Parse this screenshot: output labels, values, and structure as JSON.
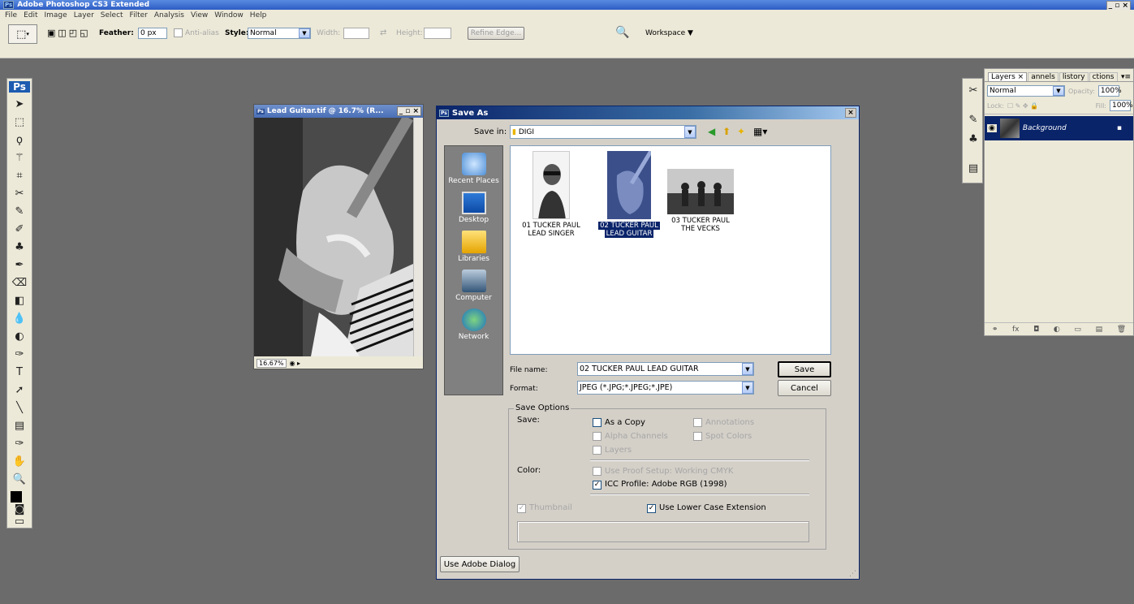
{
  "app": {
    "title": "Adobe Photoshop CS3 Extended",
    "menu": [
      "File",
      "Edit",
      "Image",
      "Layer",
      "Select",
      "Filter",
      "Analysis",
      "View",
      "Window",
      "Help"
    ]
  },
  "options": {
    "feather_label": "Feather:",
    "feather_value": "0 px",
    "antialias_label": "Anti-alias",
    "style_label": "Style:",
    "style_value": "Normal",
    "width_label": "Width:",
    "height_label": "Height:",
    "refine_label": "Refine Edge...",
    "workspace_label": "Workspace ▼"
  },
  "toolbox": {
    "logo": "Ps",
    "tools": [
      "move-tool",
      "marquee-tool",
      "lasso-tool",
      "magic-wand-tool",
      "crop-tool",
      "slice-tool",
      "healing-brush-tool",
      "brush-tool",
      "clone-stamp-tool",
      "history-brush-tool",
      "eraser-tool",
      "gradient-tool",
      "blur-tool",
      "dodge-tool",
      "pen-tool",
      "type-tool",
      "path-selection-tool",
      "line-tool",
      "notes-tool",
      "eyedropper-tool",
      "hand-tool",
      "zoom-tool"
    ],
    "glyphs": [
      "➤",
      "⬚",
      "ϙ",
      "⚚",
      "⌗",
      "✂",
      "✎",
      "✐",
      "♣",
      "✒",
      "⌫",
      "◧",
      "💧",
      "◐",
      "✑",
      "T",
      "➚",
      "╲",
      "▤",
      "✑",
      "✋",
      "🔍"
    ]
  },
  "document": {
    "title": "Lead Guitar.tif @ 16.7% (R...",
    "zoom": "16.67%"
  },
  "dialog": {
    "title": "Save As",
    "save_in_label": "Save in:",
    "folder": "DIGI",
    "places": [
      "Recent Places",
      "Desktop",
      "Libraries",
      "Computer",
      "Network"
    ],
    "files": [
      {
        "line1": "01 TUCKER PAUL",
        "line2": "LEAD SINGER"
      },
      {
        "line1": "02 TUCKER PAUL",
        "line2": "LEAD GUITAR"
      },
      {
        "line1": "03 TUCKER PAUL",
        "line2": "THE VECKS"
      }
    ],
    "filename_label": "File name:",
    "filename_value": "02 TUCKER PAUL LEAD GUITAR",
    "format_label": "Format:",
    "format_value": "JPEG (*.JPG;*.JPEG;*.JPE)",
    "save_btn": "Save",
    "cancel_btn": "Cancel",
    "options_title": "Save Options",
    "save_label": "Save:",
    "as_copy": "As a Copy",
    "annotations": "Annotations",
    "alpha": "Alpha Channels",
    "spot": "Spot Colors",
    "layers": "Layers",
    "color_label": "Color:",
    "proof": "Use Proof Setup:  Working CMYK",
    "icc": "ICC Profile:  Adobe RGB (1998)",
    "thumbnail": "Thumbnail",
    "lowercase": "Use Lower Case Extension",
    "adobe_dialog": "Use Adobe Dialog"
  },
  "layers_panel": {
    "tabs": [
      "Layers ×",
      "annels",
      "listory",
      "ctions"
    ],
    "blend": "Normal",
    "opacity_label": "Opacity:",
    "opacity_value": "100%",
    "lock_label": "Lock:",
    "fill_label": "Fill:",
    "fill_value": "100%",
    "layer_name": "Background"
  },
  "window_controls": "_ ▫ ×"
}
